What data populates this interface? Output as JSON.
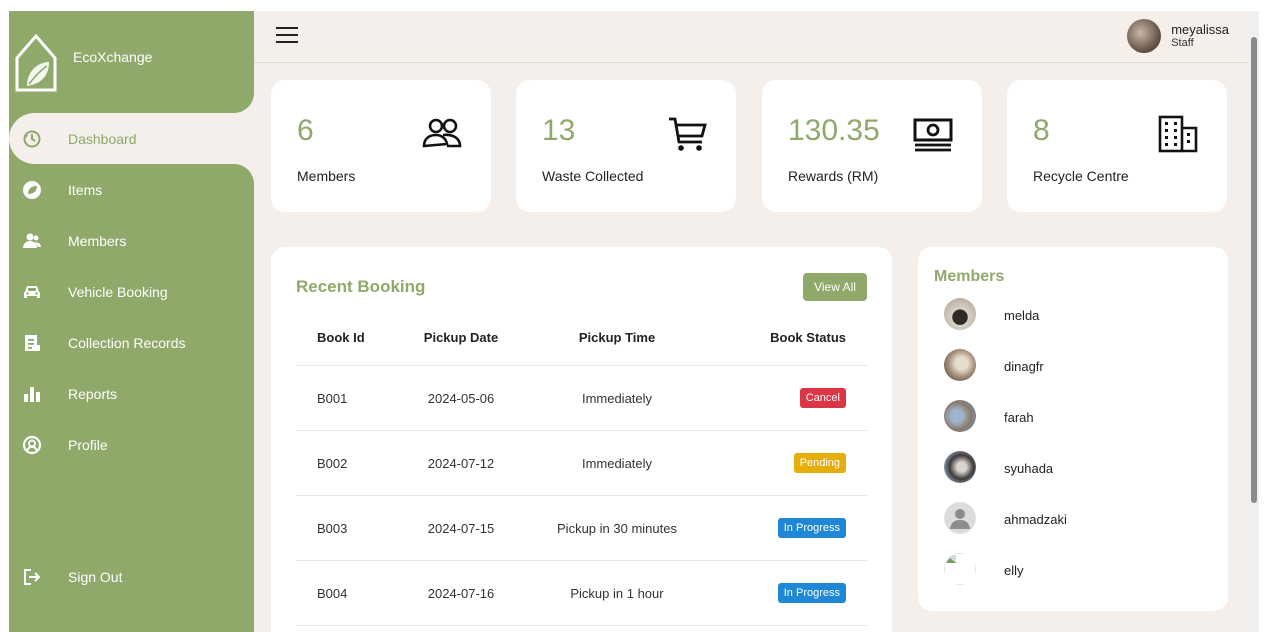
{
  "brand": {
    "name": "EcoXchange"
  },
  "sidebar": {
    "items": [
      {
        "label": "Dashboard",
        "icon": "dashboard-icon"
      },
      {
        "label": "Items",
        "icon": "leaf-icon"
      },
      {
        "label": "Members",
        "icon": "users-icon"
      },
      {
        "label": "Vehicle Booking",
        "icon": "car-icon"
      },
      {
        "label": "Collection Records",
        "icon": "document-icon"
      },
      {
        "label": "Reports",
        "icon": "bar-chart-icon"
      },
      {
        "label": "Profile",
        "icon": "profile-icon"
      }
    ],
    "signout": "Sign Out"
  },
  "header": {
    "user_name": "meyalissa",
    "user_role": "Staff"
  },
  "cards": [
    {
      "value": "6",
      "label": "Members",
      "icon": "people-icon"
    },
    {
      "value": "13",
      "label": "Waste Collected",
      "icon": "cart-icon"
    },
    {
      "value": "130.35",
      "label": "Rewards (RM)",
      "icon": "money-icon"
    },
    {
      "value": "8",
      "label": "Recycle Centre",
      "icon": "building-icon"
    }
  ],
  "recent_booking": {
    "title": "Recent Booking",
    "view_all": "View All",
    "columns": [
      "Book Id",
      "Pickup Date",
      "Pickup Time",
      "Book Status"
    ],
    "rows": [
      {
        "id": "B001",
        "date": "2024-05-06",
        "time": "Immediately",
        "status": "Cancel"
      },
      {
        "id": "B002",
        "date": "2024-07-12",
        "time": "Immediately",
        "status": "Pending"
      },
      {
        "id": "B003",
        "date": "2024-07-15",
        "time": "Pickup in 30 minutes",
        "status": "In Progress"
      },
      {
        "id": "B004",
        "date": "2024-07-16",
        "time": "Pickup in 1 hour",
        "status": "In Progress"
      }
    ]
  },
  "members_panel": {
    "title": "Members",
    "members": [
      "melda",
      "dinagfr",
      "farah",
      "syuhada",
      "ahmadzaki",
      "elly"
    ]
  },
  "colors": {
    "accent": "#8ea96a",
    "background": "#f4efea",
    "cancel": "#dc3545",
    "pending": "#e6ad0b",
    "in_progress": "#1e88d6"
  }
}
